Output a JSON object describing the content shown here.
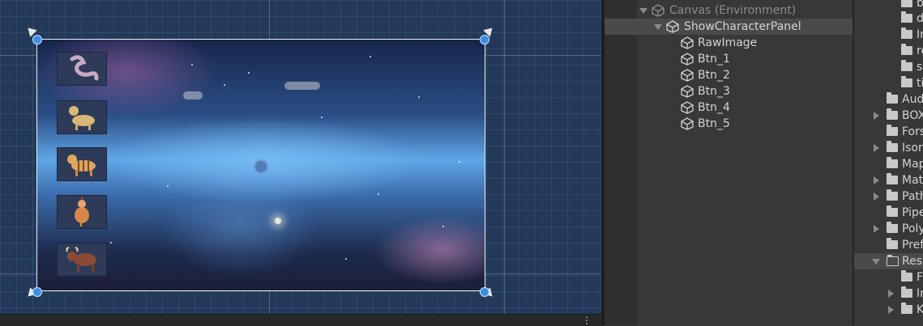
{
  "scene": {
    "thumbnails": [
      {
        "name": "worm-character-icon"
      },
      {
        "name": "dog-character-icon"
      },
      {
        "name": "tiger-character-icon"
      },
      {
        "name": "chicken-character-icon"
      },
      {
        "name": "bull-character-icon"
      }
    ],
    "overflow_menu": "⋮"
  },
  "hierarchy": {
    "items": [
      {
        "label": "Canvas (Environment)",
        "disabled": true
      },
      {
        "label": "ShowCharacterPanel",
        "selected": true
      },
      {
        "label": "RawImage"
      },
      {
        "label": "Btn_1"
      },
      {
        "label": "Btn_2"
      },
      {
        "label": "Btn_3"
      },
      {
        "label": "Btn_4"
      },
      {
        "label": "Btn_5"
      }
    ]
  },
  "project": {
    "items": [
      {
        "label": "b"
      },
      {
        "label": "d"
      },
      {
        "label": "In"
      },
      {
        "label": "ro"
      },
      {
        "label": "s"
      },
      {
        "label": "ti"
      },
      {
        "label": "Aud"
      },
      {
        "label": "BOX"
      },
      {
        "label": "Fors"
      },
      {
        "label": "Isor"
      },
      {
        "label": "Map"
      },
      {
        "label": "Mat"
      },
      {
        "label": "Path"
      },
      {
        "label": "Pipe"
      },
      {
        "label": "Poly"
      },
      {
        "label": "Pref"
      },
      {
        "label": "Res"
      },
      {
        "label": "F"
      },
      {
        "label": "In"
      },
      {
        "label": "K"
      }
    ]
  }
}
